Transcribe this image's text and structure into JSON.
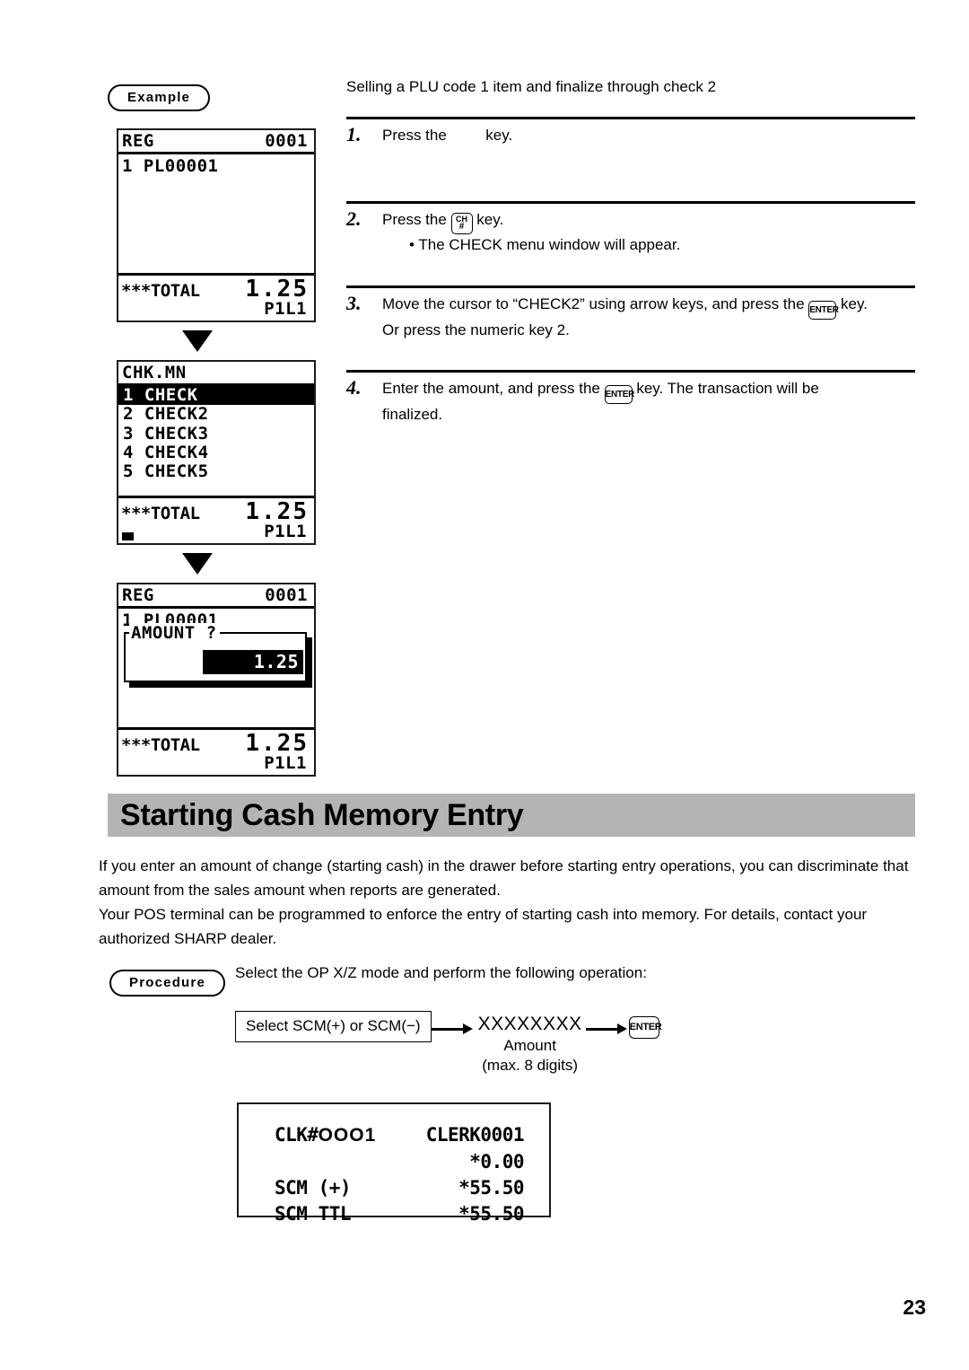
{
  "example": {
    "badge_label": "Example",
    "intro": "Selling a PLU code 1 item and finalize through check 2",
    "displays": [
      {
        "name": "reg-plu-display",
        "mode": "REG",
        "counter": "0001",
        "lines": [
          "1 PL00001"
        ],
        "total_label": "***TOTAL",
        "total_amount": "1.25",
        "page_line": "P1L1"
      },
      {
        "name": "check-menu-display",
        "mode": "CHK.MN",
        "counter": "",
        "menu": [
          {
            "num": "1",
            "label": "CHECK",
            "selected": true
          },
          {
            "num": "2",
            "label": "CHECK2",
            "selected": false
          },
          {
            "num": "3",
            "label": "CHECK3",
            "selected": false
          },
          {
            "num": "4",
            "label": "CHECK4",
            "selected": false
          },
          {
            "num": "5",
            "label": "CHECK5",
            "selected": false
          }
        ],
        "total_label": "***TOTAL",
        "total_amount": "1.25",
        "page_line": "P1L1"
      },
      {
        "name": "amount-entry-display",
        "mode": "REG",
        "counter": "0001",
        "lines": [
          "1 PL00001"
        ],
        "dialog_label": "AMOUNT ?",
        "dialog_value": "1.25",
        "total_label": "***TOTAL",
        "total_amount": "1.25",
        "page_line": "P1L1"
      }
    ],
    "steps": [
      {
        "num": "1",
        "text_before": "Press the",
        "key": "",
        "text_after": "key.",
        "sub": ""
      },
      {
        "num": "2",
        "text_before": "Press the",
        "key": "CH#",
        "key_line1": "CH",
        "key_line2": "#",
        "text_after": "key.",
        "sub": "• The CHECK menu window will appear."
      },
      {
        "num": "3",
        "text_before": "Move the cursor to “CHECK2” using arrow keys, and press the",
        "key": "ENTER",
        "text_after": "key.",
        "sub": "Or press the numeric key 2."
      },
      {
        "num": "4",
        "text_before": "Enter the amount, and press the",
        "key": "ENTER",
        "text_after": "key.  The transaction will be",
        "sub": "finalized."
      }
    ]
  },
  "section": {
    "heading": "Starting Cash Memory Entry",
    "paragraphs": [
      "If you enter an amount of change (starting cash) in the drawer before starting entry operations, you can discriminate that amount from the sales amount when reports are generated.",
      "Your POS terminal can be programmed to enforce the entry of starting cash into memory. For details, contact your authorized SHARP dealer."
    ]
  },
  "procedure": {
    "badge_label": "Procedure",
    "intro": "Select the OP X/Z mode and perform the following operation:",
    "flow": {
      "box_label": "Select SCM(+) or SCM(−)",
      "amount_placeholder": "XXXXXXXX",
      "amount_caption": "Amount",
      "amount_note": "(max. 8 digits)",
      "enter_key": "ENTER"
    }
  },
  "receipt": {
    "clerk_label_prefix": "CLK#",
    "clerk_label_zeros": "OOO",
    "clerk_label_suffix": "1",
    "clerk_name": "CLERK0001",
    "rows": [
      {
        "left": "",
        "right": "*0.00"
      },
      {
        "left": "SCM (+)",
        "right": "*55.50"
      },
      {
        "left": "SCM TTL",
        "right": "*55.50"
      }
    ]
  },
  "footer": {
    "page_number": "23"
  },
  "colors": {
    "heading_bar": "#b4b4b4",
    "ink": "#000000",
    "paper": "#ffffff"
  }
}
